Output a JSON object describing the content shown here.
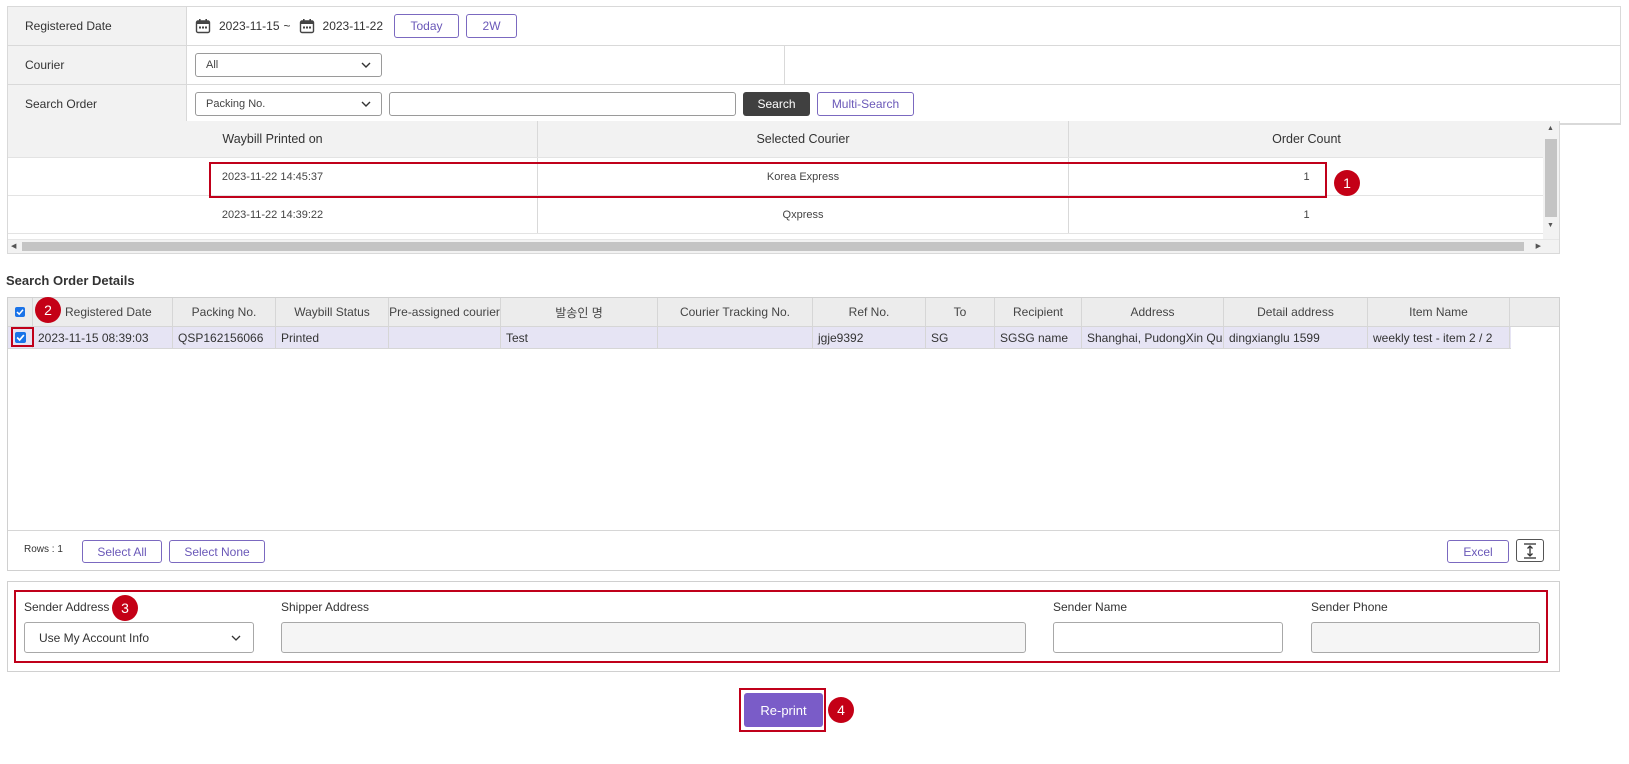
{
  "filters": {
    "registered_date": {
      "label": "Registered Date",
      "from": "2023-11-15",
      "separator": "~",
      "to": "2023-11-22",
      "today_label": "Today",
      "twoweeks_label": "2W"
    },
    "courier": {
      "label": "Courier",
      "selected": "All"
    },
    "search_order": {
      "label": "Search Order",
      "field_selected": "Packing No.",
      "query_value": "",
      "search_label": "Search",
      "multi_search_label": "Multi-Search"
    }
  },
  "waybill_table": {
    "columns": [
      "Waybill Printed on",
      "Selected Courier",
      "Order Count"
    ],
    "rows": [
      {
        "printed_on": "2023-11-22 14:45:37",
        "courier": "Korea Express",
        "count": "1"
      },
      {
        "printed_on": "2023-11-22 14:39:22",
        "courier": "Qxpress",
        "count": "1"
      }
    ]
  },
  "order_details": {
    "title": "Search Order Details",
    "columns": [
      "Registered Date",
      "Packing No.",
      "Waybill Status",
      "Pre-assigned courier",
      "발송인 명",
      "Courier Tracking No.",
      "Ref No.",
      "To",
      "Recipient",
      "Address",
      "Detail address",
      "Item Name"
    ],
    "rows": [
      {
        "registered_date": "2023-11-15 08:39:03",
        "packing_no": "QSP162156066",
        "waybill_status": "Printed",
        "pre_assigned_courier": "",
        "sender_name": "Test",
        "tracking_no": "",
        "ref_no": "jgje9392",
        "to": "SG",
        "recipient": "SGSG name",
        "address": "Shanghai, PudongXin Qu",
        "detail_address": "dingxianglu 1599",
        "item_name": "weekly test - item 2 / 2"
      }
    ],
    "rows_label": "Rows : 1",
    "select_all_label": "Select All",
    "select_none_label": "Select None",
    "excel_label": "Excel"
  },
  "sender": {
    "sender_address_label": "Sender Address",
    "sender_address_selected": "Use My Account Info",
    "shipper_address_label": "Shipper Address",
    "shipper_address_value": "",
    "sender_name_label": "Sender Name",
    "sender_name_value": "",
    "sender_phone_label": "Sender Phone",
    "sender_phone_value": ""
  },
  "reprint_label": "Re-print",
  "annotations": [
    "1",
    "2",
    "3",
    "4"
  ],
  "colors": {
    "accent": "#7a5cc8",
    "highlight": "#c0001a",
    "selected_row": "#e6e4f4",
    "checkbox": "#1a73e8"
  }
}
